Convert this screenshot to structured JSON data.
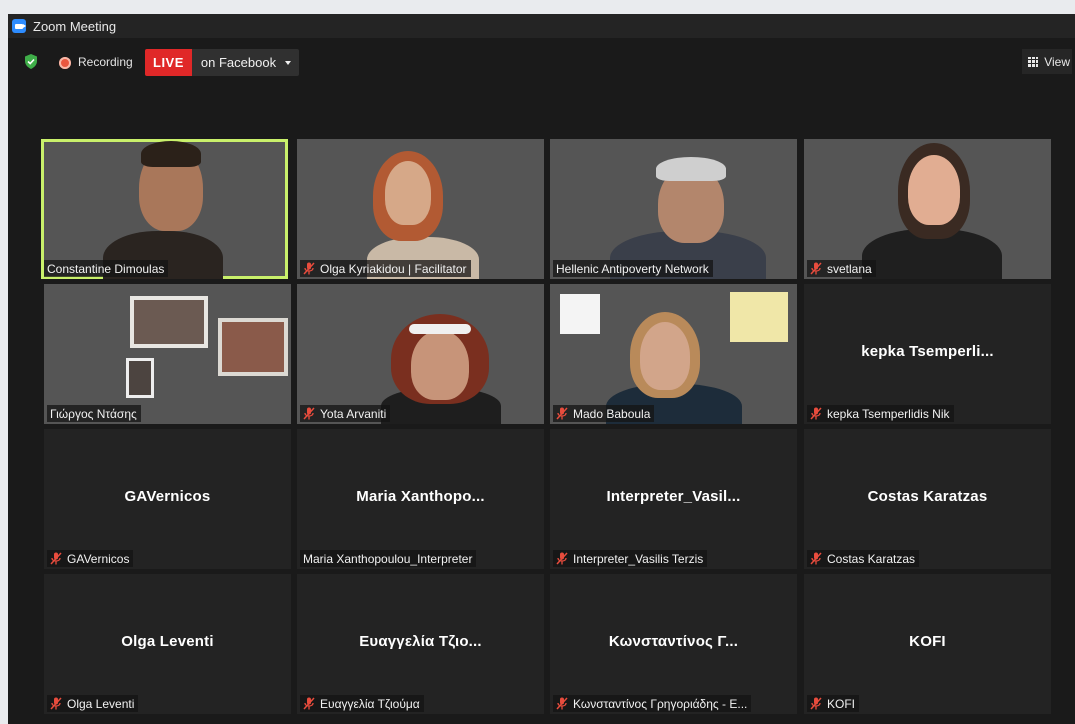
{
  "window": {
    "title": "Zoom Meeting"
  },
  "toolbar": {
    "recording_label": "Recording",
    "live_label": "LIVE",
    "live_destination": "on Facebook",
    "view_label": "View"
  },
  "colors": {
    "live_red": "#e02828",
    "active_speaker_border": "#c9f06b",
    "muted_mic_red": "#e84c3d",
    "shield_green": "#3fae49"
  },
  "participants": [
    {
      "display": "",
      "name": "Constantine Dimoulas",
      "muted": false,
      "video": true,
      "active": true
    },
    {
      "display": "",
      "name": "Olga Kyriakidou | Facilitator",
      "muted": true,
      "video": true,
      "active": false
    },
    {
      "display": "",
      "name": "Hellenic Antipoverty Network",
      "muted": false,
      "video": true,
      "active": false
    },
    {
      "display": "",
      "name": "svetlana",
      "muted": true,
      "video": true,
      "active": false
    },
    {
      "display": "",
      "name": "Γιώργος Ντάσης",
      "muted": false,
      "video": true,
      "active": false
    },
    {
      "display": "",
      "name": "Yota Arvaniti",
      "muted": true,
      "video": true,
      "active": false
    },
    {
      "display": "",
      "name": "Mado Baboula",
      "muted": true,
      "video": true,
      "active": false
    },
    {
      "display": "kepka  Tsemperli...",
      "name": "kepka Tsemperlidis Nik",
      "muted": true,
      "video": false,
      "active": false
    },
    {
      "display": "GAVernicos",
      "name": "GAVernicos",
      "muted": true,
      "video": false,
      "active": false
    },
    {
      "display": "Maria  Xanthopo...",
      "name": "Maria Xanthopoulou_Interpreter",
      "muted": false,
      "video": false,
      "active": false
    },
    {
      "display": "Interpreter_Vasil...",
      "name": "Interpreter_Vasilis Terzis",
      "muted": true,
      "video": false,
      "active": false
    },
    {
      "display": "Costas Karatzas",
      "name": "Costas Karatzas",
      "muted": true,
      "video": false,
      "active": false
    },
    {
      "display": "Olga Leventi",
      "name": "Olga Leventi",
      "muted": true,
      "video": false,
      "active": false
    },
    {
      "display": "Ευαγγελία Τζιο...",
      "name": "Ευαγγελία Τζιούμα",
      "muted": true,
      "video": false,
      "active": false
    },
    {
      "display": "Κωνσταντίνος Γ...",
      "name": "Κωνσταντίνος Γρηγοριάδης - Ε...",
      "muted": true,
      "video": false,
      "active": false
    },
    {
      "display": "KOFI",
      "name": "KOFI",
      "muted": true,
      "video": false,
      "active": false
    }
  ]
}
